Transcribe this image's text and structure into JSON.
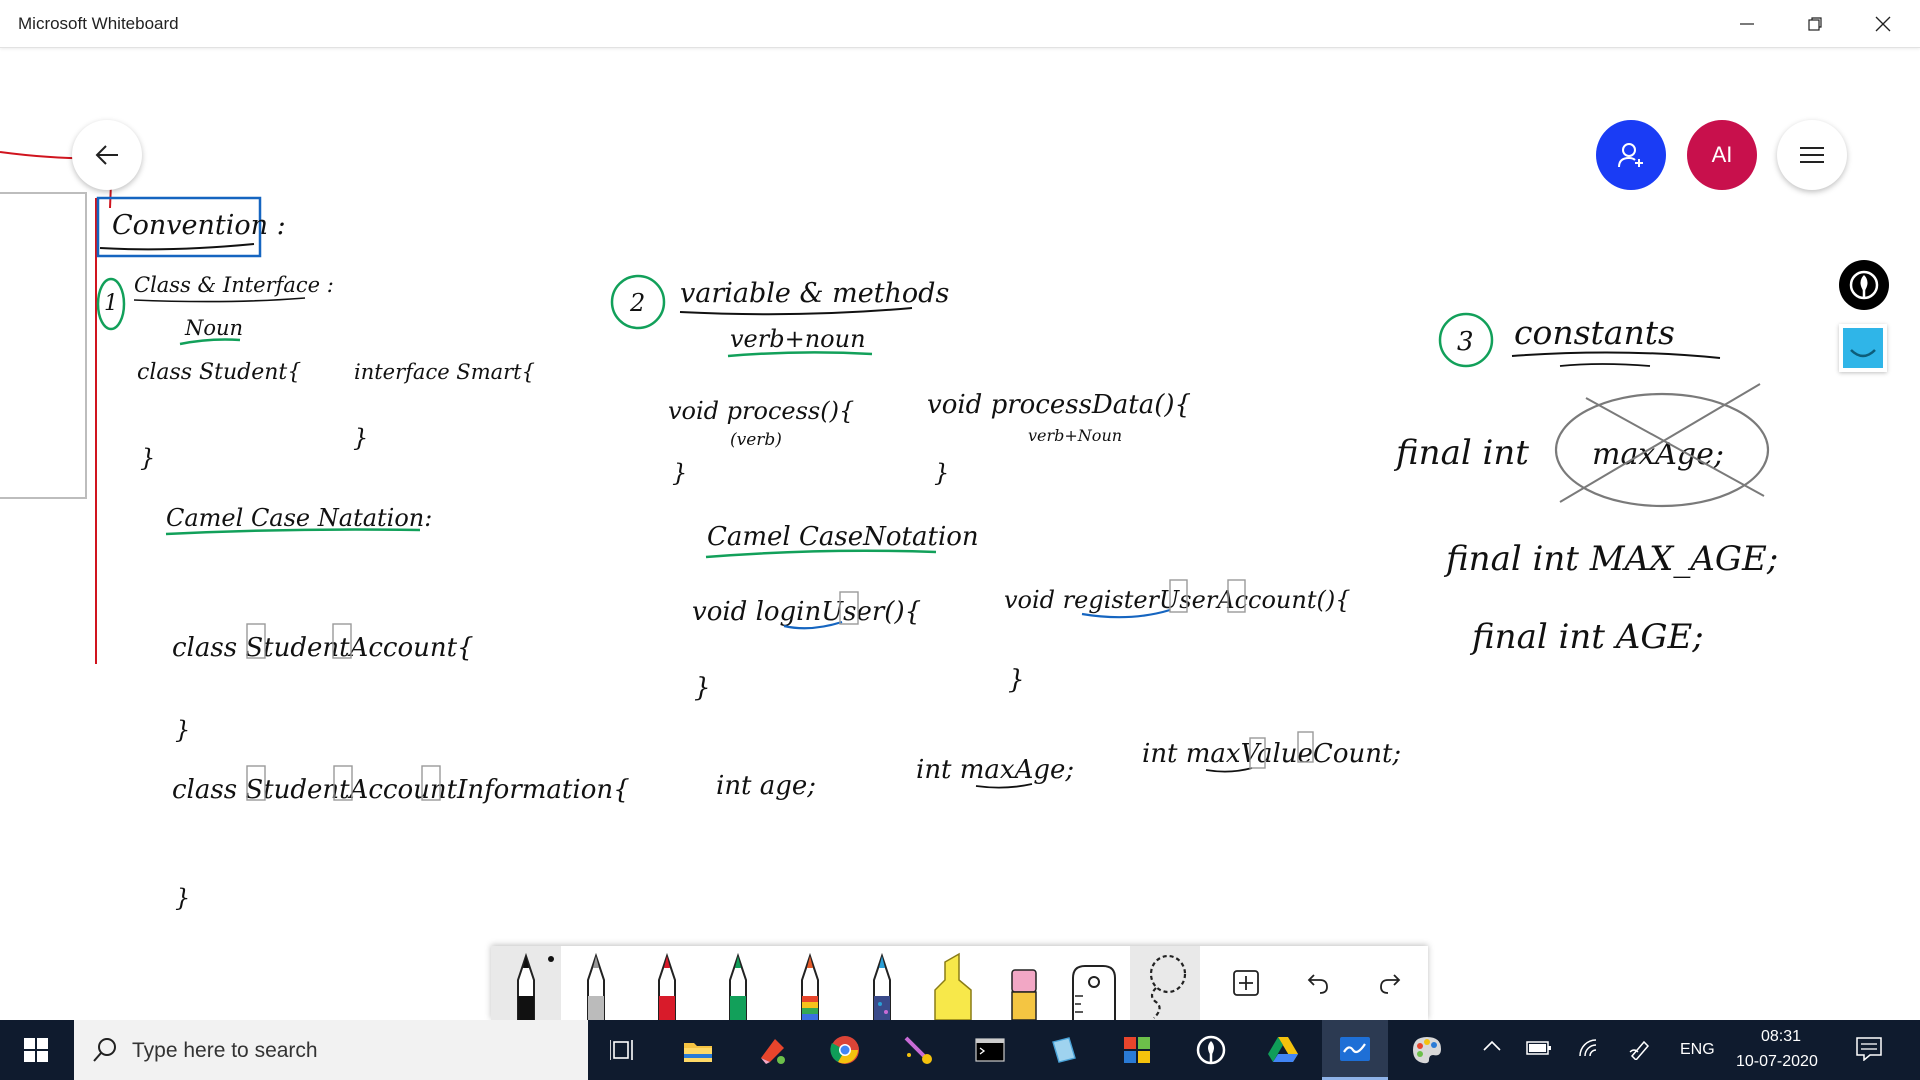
{
  "window": {
    "title": "Microsoft Whiteboard",
    "buttons": [
      "minimize",
      "restore",
      "close"
    ]
  },
  "header": {
    "back_icon": "arrow-left-icon",
    "invite_icon": "person-add-icon",
    "avatar_initials": "AI",
    "menu_icon": "hamburger-icon",
    "colors": {
      "invite": "#1a3cf5",
      "avatar": "#c8104c"
    }
  },
  "side_tools": [
    "ink-pen-icon",
    "smiley-sticker-icon"
  ],
  "board": {
    "convention_title": "Convention :",
    "section1": {
      "number": "1",
      "heading": "Class & Interface :",
      "sub": "Noun",
      "code_class": "class Student{",
      "code_interface": "interface Smart{",
      "brace": "}",
      "camel_heading": "Camel Case Natation:",
      "camel_ex1": "class StudentAccount{",
      "camel_ex2": "class StudentAccountInformation{"
    },
    "section2": {
      "number": "2",
      "heading": "variable & methods",
      "sub": "verb+noun",
      "ex1": "void process(){",
      "ex1_note": "(verb)",
      "ex2": "void processData(){",
      "ex2_note": "verb+Noun",
      "camel_heading": "Camel CaseNotation",
      "camel_ex1": "void loginUser(){",
      "camel_ex2": "void registerUserAccount(){",
      "vars": [
        "int age;",
        "int maxAge;",
        "int maxValueCount;"
      ],
      "brace": "}"
    },
    "section3": {
      "number": "3",
      "heading": "constants",
      "bad_prefix": "final int",
      "bad_name": "maxAge;",
      "good1": "final int MAX_AGE;",
      "good2": "final int AGE;"
    }
  },
  "toolbar": {
    "tools": [
      "black-pen",
      "silver-pen",
      "red-pen",
      "green-pen",
      "rainbow-pen",
      "galaxy-pen",
      "yellow-highlighter",
      "eraser",
      "ruler",
      "lasso-select",
      "add-icon",
      "undo-icon",
      "redo-icon"
    ],
    "pen_colors": [
      "#111111",
      "#bbbbbb",
      "#d81b2a",
      "#12a05a",
      "#e65c2b",
      "#2a9fd6",
      "#f7e84a",
      "#f2a7c5"
    ]
  },
  "taskbar": {
    "search_placeholder": "Type here to search",
    "apps": [
      "task-view-icon",
      "file-explorer-icon",
      "app-icon",
      "chrome-icon",
      "paint-3d-icon",
      "terminal-icon",
      "notepad-icon",
      "office-icon",
      "pen-app-icon",
      "google-drive-icon",
      "whiteboard-icon",
      "paint-icon"
    ],
    "language": "ENG",
    "time": "08:31",
    "date": "10-07-2020"
  }
}
